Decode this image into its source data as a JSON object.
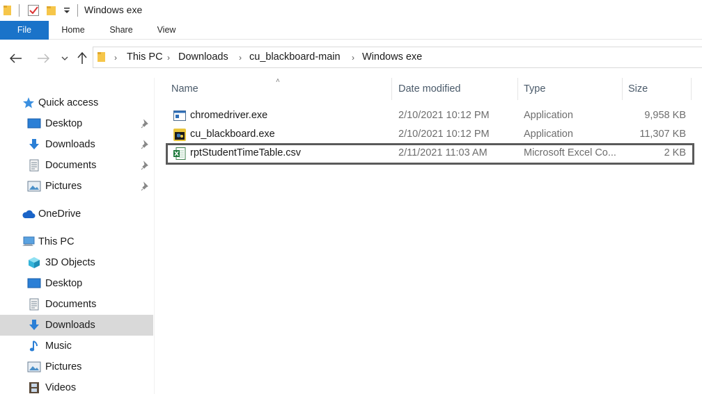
{
  "window": {
    "title": "Windows exe"
  },
  "quick_access_icons": [
    "folder-icon",
    "properties-check-icon",
    "new-folder-icon",
    "customize-dropdown-icon"
  ],
  "ribbon": {
    "tabs": [
      "File",
      "Home",
      "Share",
      "View"
    ],
    "accent": "#1a73c9"
  },
  "breadcrumb": [
    "This PC",
    "Downloads",
    "cu_blackboard-main",
    "Windows exe"
  ],
  "sidebar": {
    "quick_access": {
      "label": "Quick access",
      "items": [
        "Desktop",
        "Downloads",
        "Documents",
        "Pictures"
      ]
    },
    "onedrive": {
      "label": "OneDrive"
    },
    "this_pc": {
      "label": "This PC",
      "items": [
        "3D Objects",
        "Desktop",
        "Documents",
        "Downloads",
        "Music",
        "Pictures",
        "Videos"
      ],
      "selected": "Downloads"
    }
  },
  "columns": [
    "Name",
    "Date modified",
    "Type",
    "Size"
  ],
  "files": [
    {
      "name": "chromedriver.exe",
      "date": "2/10/2021 10:12 PM",
      "type": "Application",
      "size": "9,958 KB",
      "icon": "application-icon"
    },
    {
      "name": "cu_blackboard.exe",
      "date": "2/10/2021 10:12 PM",
      "type": "Application",
      "size": "11,307 KB",
      "icon": "python-exe-icon"
    },
    {
      "name": "rptStudentTimeTable.csv",
      "date": "2/11/2021 11:03 AM",
      "type": "Microsoft Excel Co...",
      "size": "2 KB",
      "icon": "excel-csv-icon"
    }
  ]
}
